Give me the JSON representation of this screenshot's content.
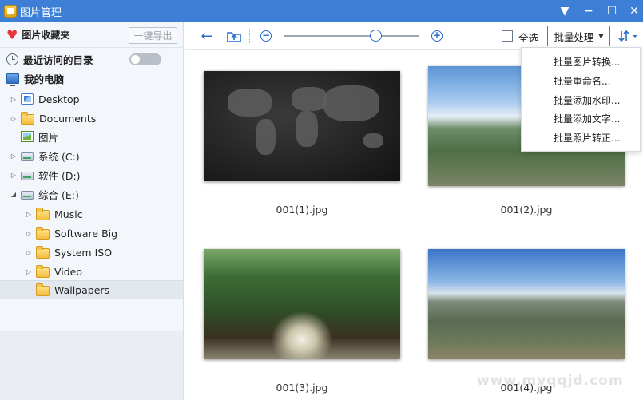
{
  "window": {
    "title": "图片管理"
  },
  "sidebar": {
    "favorites": {
      "title": "图片收藏夹",
      "export_label": "一键导出"
    },
    "recent": {
      "label": "最近访问的目录",
      "toggle_on": false
    },
    "my_computer": "我的电脑",
    "tree": [
      {
        "label": "Desktop"
      },
      {
        "label": "Documents"
      },
      {
        "label": "图片"
      },
      {
        "label": "系统 (C:)"
      },
      {
        "label": "软件 (D:)"
      },
      {
        "label": "综合 (E:)"
      },
      {
        "label": "Music"
      },
      {
        "label": "Software Big"
      },
      {
        "label": "System ISO"
      },
      {
        "label": "Video"
      },
      {
        "label": "Wallpapers",
        "selected": true
      }
    ]
  },
  "toolbar": {
    "zoom_level": 0.68,
    "select_all": "全选",
    "batch_label": "批量处理"
  },
  "batch_menu": [
    "批量图片转换...",
    "批量重命名...",
    "批量添加水印...",
    "批量添加文字...",
    "批量照片转正..."
  ],
  "files": [
    {
      "name": "001(1).jpg"
    },
    {
      "name": "001(2).jpg"
    },
    {
      "name": "001(3).jpg"
    },
    {
      "name": "001(4).jpg"
    }
  ],
  "watermark": "www.myqqjd.com",
  "colors": {
    "accent": "#3d7fd6",
    "titlebar": "#3d7fd6",
    "heart": "#e8333a"
  }
}
